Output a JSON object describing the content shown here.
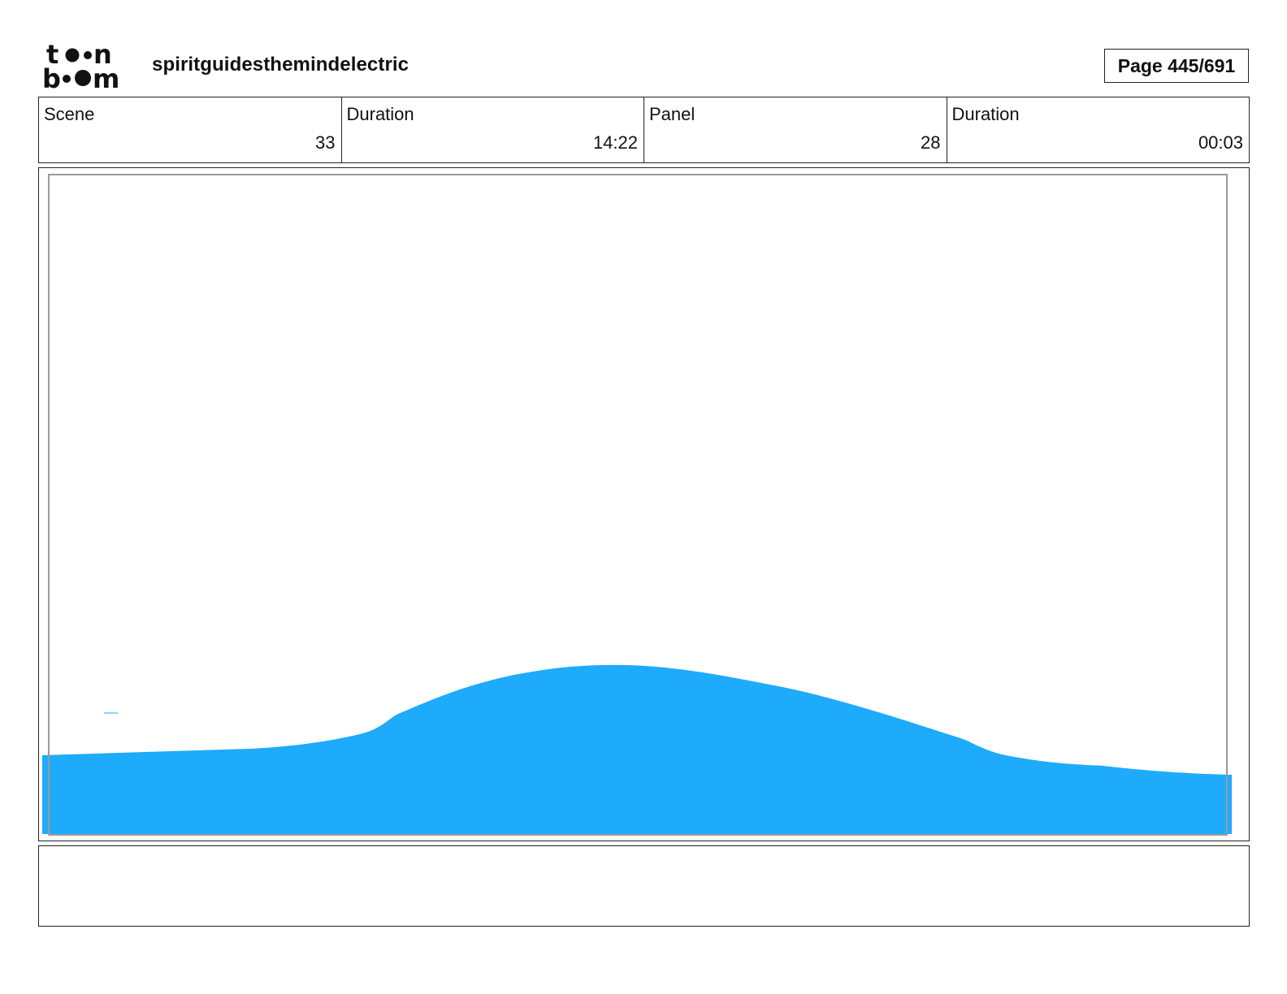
{
  "header": {
    "logo": {
      "top_line": "toon",
      "bottom_line": "boom"
    },
    "project_title": "spiritguidesthemindelectric",
    "page_counter": "Page 445/691"
  },
  "info": {
    "scene": {
      "label": "Scene",
      "value": "33"
    },
    "scene_duration": {
      "label": "Duration",
      "value": "14:22"
    },
    "panel": {
      "label": "Panel",
      "value": "28"
    },
    "panel_duration": {
      "label": "Duration",
      "value": "00:03"
    }
  },
  "colors": {
    "water": "#1eabfb",
    "safe_area_border": "#9a9a9a",
    "frame_border": "#222222"
  },
  "notes": {
    "text": ""
  }
}
